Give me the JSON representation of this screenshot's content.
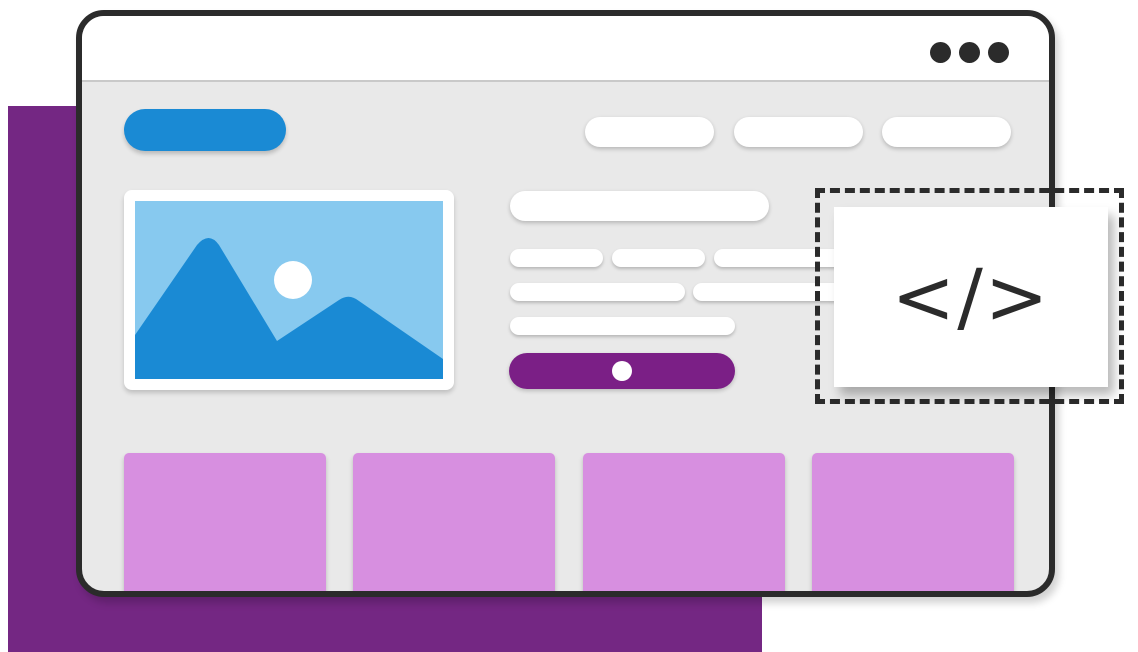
{
  "illustration": {
    "code_glyph": "</>",
    "icon": "code-icon"
  },
  "colors": {
    "backdrop": "#742783",
    "window_frame": "#2b2b2b",
    "window_body": "#e9e9e9",
    "logo_accent": "#1a8ad4",
    "image_sky": "#87c9ef",
    "image_mountain": "#1a8ad4",
    "button_accent": "#7b1f86",
    "card_fill": "#d78fe0"
  }
}
